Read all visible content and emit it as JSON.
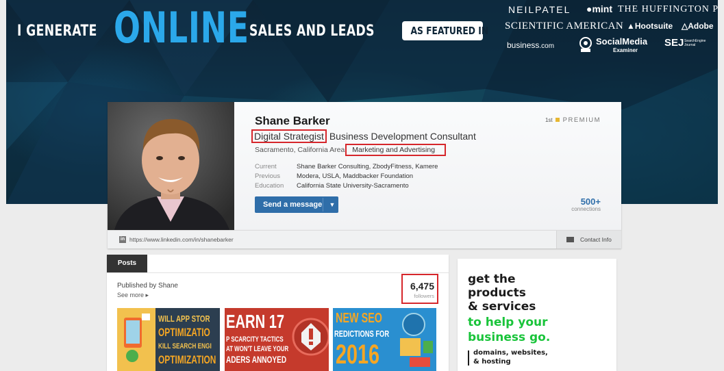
{
  "banner": {
    "tag_part1": "I GENERATE",
    "tag_part2": "ONLINE",
    "tag_part3": "SALES AND LEADS",
    "featured_label": "AS FEATURED IN",
    "logos": {
      "neilpatel": "NEILPATEL",
      "mint": "mint",
      "huffington": "THE HUFFINGTON POST",
      "sciam": "SCIENTIFIC AMERICAN",
      "hootsuite": "Hootsuite",
      "adobe": "Adobe",
      "business": "business",
      "business_suffix": ".com",
      "sme_main": "SocialMedia",
      "sme_sub": "Examiner",
      "sej": "SEJ",
      "sej_sub": "SearchEngine Journal"
    }
  },
  "profile": {
    "name": "Shane Barker",
    "headline_highlight": "Digital Strategist",
    "headline_rest": "Business Development Consultant",
    "location": "Sacramento, California Area",
    "industry": "Marketing and Advertising",
    "meta": [
      {
        "key": "Current",
        "value": "Shane Barker Consulting, ZbodyFitness, Kamere"
      },
      {
        "key": "Previous",
        "value": "Modera, USLA, Maddbacker Foundation"
      },
      {
        "key": "Education",
        "value": "California State University-Sacramento"
      }
    ],
    "send_message": "Send a message",
    "premium_degree": "1st",
    "premium_label": "PREMIUM",
    "connections_count": "500+",
    "connections_label": "connections",
    "url_icon": "in",
    "url": "https://www.linkedin.com/in/shanebarker",
    "contact_info": "Contact Info"
  },
  "posts": {
    "tab": "Posts",
    "published_by": "Published by Shane",
    "see_more": "See more ▸",
    "followers_count": "6,475",
    "followers_label": "followers",
    "thumb1": {
      "l1": "WILL APP STOR",
      "l2": "OPTIMIZATIO",
      "l3": "KILL SEARCH ENGI",
      "l4": "OPTIMIZATION"
    },
    "thumb2": {
      "l1": "EARN 17",
      "l2": "P SCARCITY TACTICS",
      "l3": "AT WON'T LEAVE YOUR",
      "l4": "ADERS ANNOYED"
    },
    "thumb3": {
      "l1": "NEW SEO",
      "l2": "REDICTIONS FOR",
      "l3": "2016"
    }
  },
  "ad": {
    "line1": "get the",
    "line2": "products",
    "line3": "& services",
    "line4": "to help your",
    "line5": "business go.",
    "small1": "domains, websites,",
    "small2": "& hosting"
  }
}
